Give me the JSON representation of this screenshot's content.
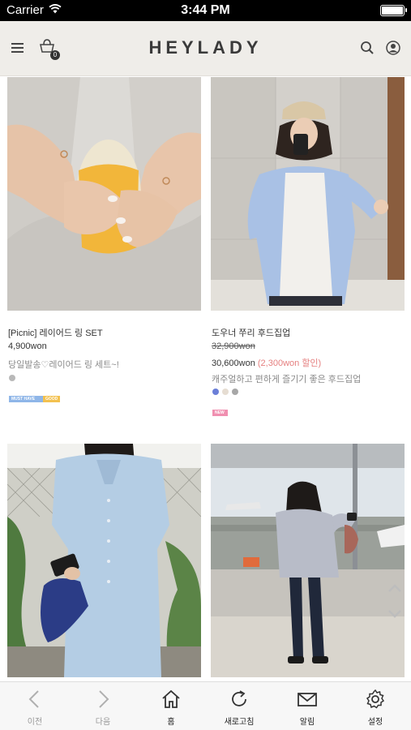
{
  "status_bar": {
    "carrier": "Carrier",
    "time": "3:44 PM"
  },
  "header": {
    "logo": "HEYLADY",
    "cart_count": "0"
  },
  "products": [
    {
      "name": "[Picnic] 레이어드 링 SET",
      "price": "4,900won",
      "description": "당일발송♡레이어드 링 세트~!",
      "colors": [
        "#b8b8b8"
      ],
      "badges": [
        {
          "text": "MUST HAVE",
          "color": "#8fb6e8"
        },
        {
          "text": "GOOD",
          "color": "#f3c14f"
        }
      ]
    },
    {
      "name": "도우너 쭈리 후드집업",
      "old_price": "32,900won",
      "price": "30,600won",
      "sale": "(2,300won 할인)",
      "description": "캐주얼하고 편하게 즐기기 좋은 후드집업",
      "colors": [
        "#6b7fd8",
        "#e6ddd2",
        "#a7a7a7"
      ],
      "badges": [
        {
          "text": "NEW",
          "color": "#f08fb0"
        }
      ]
    },
    {
      "name": "",
      "price": ""
    },
    {
      "name": "",
      "price": ""
    }
  ],
  "tabbar": {
    "back": "이전",
    "forward": "다음",
    "home": "홈",
    "refresh": "새로고침",
    "notify": "알림",
    "settings": "설정"
  }
}
